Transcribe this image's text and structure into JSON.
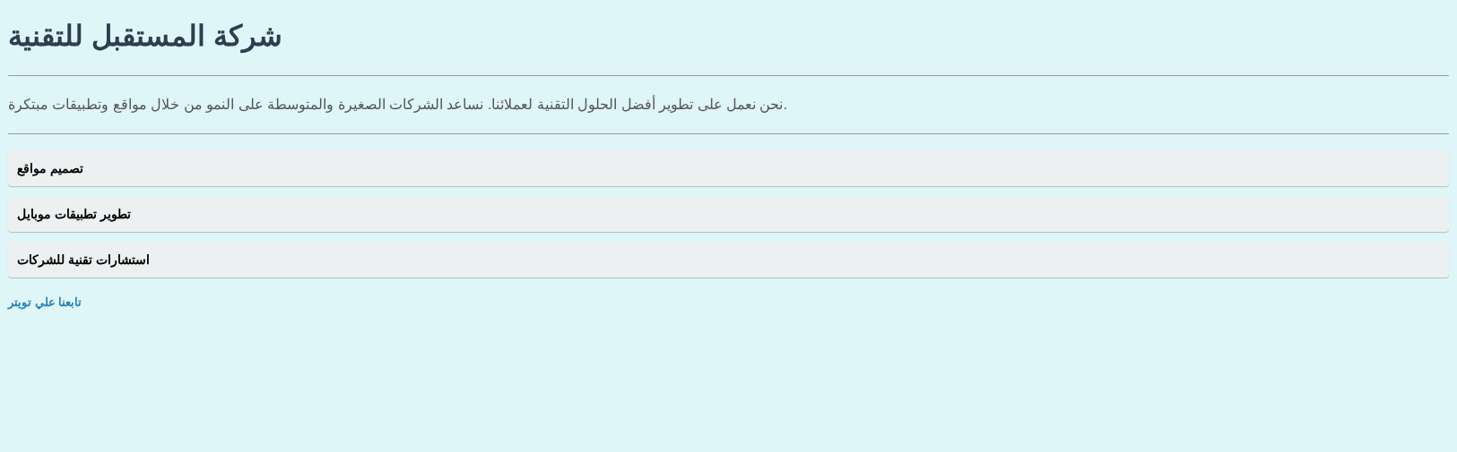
{
  "title": "شركة المستقبل للتقنية",
  "description": "نحن نعمل على تطوير أفضل الحلول التقنية لعملائنا. نساعد الشركات الصغيرة والمتوسطة على النمو من خلال مواقع وتطبيقات مبتكرة.",
  "services": [
    "تصميم مواقع",
    "تطوير تطبيقات موبايل",
    "استشارات تقنية للشركات"
  ],
  "link": "تابعنا علي تويتر"
}
